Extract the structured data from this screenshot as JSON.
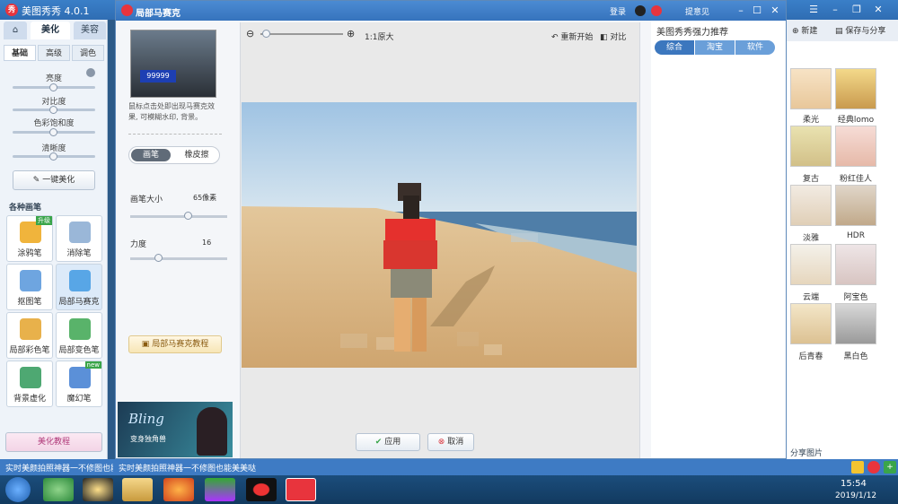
{
  "app": {
    "title": "美图秀秀 4.0.1",
    "logo": "秀",
    "login": "登录",
    "menu": "提意见"
  },
  "main_tabs": [
    "美化",
    "美容"
  ],
  "sub_tabs": [
    "基础",
    "高级",
    "调色"
  ],
  "sliders": {
    "brightness": "亮度",
    "contrast": "对比度",
    "saturation": "色彩饱和度",
    "sharpness": "清晰度"
  },
  "one_click": "一键美化",
  "tools_header": "各种画笔",
  "tools": [
    {
      "label": "涂鸦笔",
      "badge": "升级",
      "color": "#f0b43c"
    },
    {
      "label": "消除笔",
      "badge": "",
      "color": "#9ab7d8"
    },
    {
      "label": "抠图笔",
      "badge": "",
      "color": "#6ea5e0"
    },
    {
      "label": "局部马赛克",
      "badge": "",
      "color": "#58a6e6"
    },
    {
      "label": "局部彩色笔",
      "badge": "",
      "color": "#e8b14b"
    },
    {
      "label": "局部变色笔",
      "badge": "",
      "color": "#59b36a"
    },
    {
      "label": "背景虚化",
      "badge": "",
      "color": "#4ea872"
    },
    {
      "label": "魔幻笔",
      "badge": "new",
      "color": "#5b90d8"
    }
  ],
  "tutorial": "美化教程",
  "dialog": {
    "title": "局部马赛克",
    "desc": "鼠标点击处即出现马赛克效果, 可模糊水印, 背景。",
    "brush_tab": "画笔",
    "eraser_tab": "橡皮擦",
    "brush_size_label": "画笔大小",
    "brush_size_value": "65像素",
    "brush_size_fraction": 0.6,
    "strength_label": "力度",
    "strength_value": "16",
    "strength_fraction": 0.3,
    "tutorial_btn": "局部马赛克教程",
    "plate": "99999",
    "zoom_label": "1:1原大",
    "restart": "重新开始",
    "compare": "对比",
    "apply": "应用",
    "cancel": "取消",
    "ad_title": "Bling",
    "ad_sub": "变身独角兽"
  },
  "recommend": {
    "title": "美图秀秀强力推荐",
    "tabs": [
      "综合",
      "淘宝",
      "软件"
    ]
  },
  "gallery": {
    "new_label": "新建",
    "save_label": "保存与分享",
    "share_label": "分享图片",
    "effects": [
      "柔光",
      "经典lomo",
      "复古",
      "粉红佳人",
      "淡雅",
      "HDR",
      "云端",
      "阿宝色",
      "后青春",
      "黑白色"
    ]
  },
  "status": {
    "ticker": "实时美颜拍照神器一不修图也能美美哒"
  },
  "taskbar": {
    "time": "15:54",
    "date": "2019/1/12"
  }
}
